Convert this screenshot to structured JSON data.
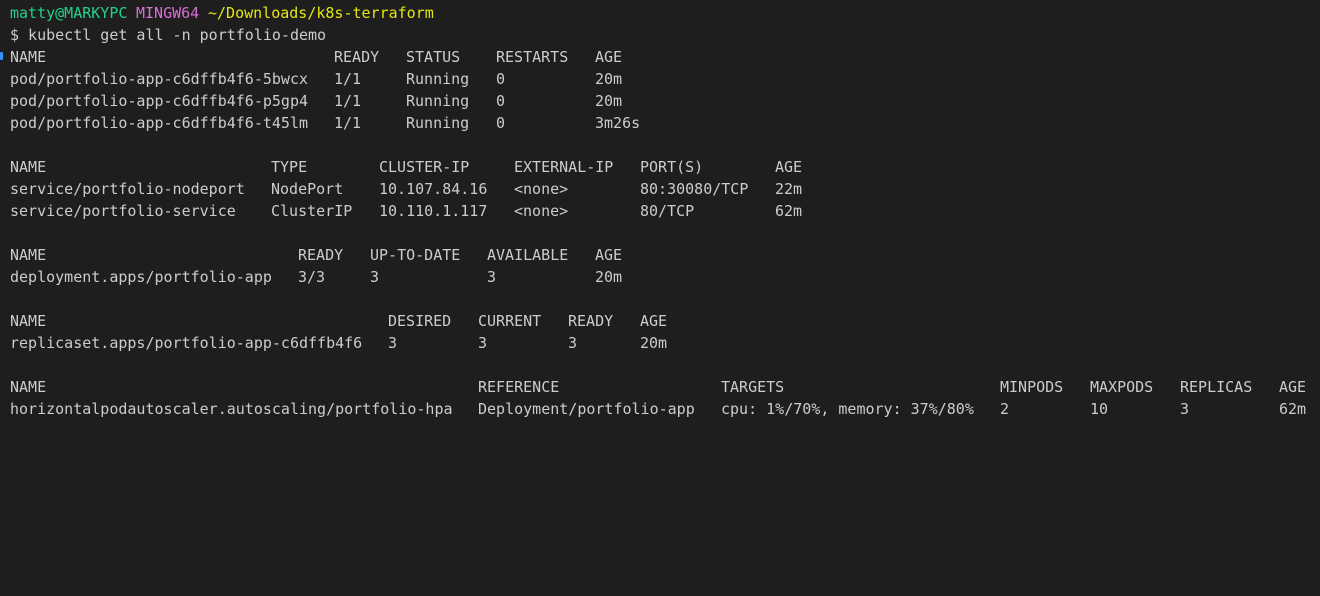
{
  "prompt": {
    "user_host": "matty@MARKYPC",
    "system": "MINGW64",
    "cwd": "~/Downloads/k8s-terraform"
  },
  "command": "$ kubectl get all -n portfolio-demo",
  "sections": [
    {
      "name": "pods",
      "headers": [
        "NAME",
        "READY",
        "STATUS",
        "RESTARTS",
        "AGE"
      ],
      "rows": [
        [
          "pod/portfolio-app-c6dffb4f6-5bwcx",
          "1/1",
          "Running",
          "0",
          "20m"
        ],
        [
          "pod/portfolio-app-c6dffb4f6-p5gp4",
          "1/1",
          "Running",
          "0",
          "20m"
        ],
        [
          "pod/portfolio-app-c6dffb4f6-t45lm",
          "1/1",
          "Running",
          "0",
          "3m26s"
        ]
      ]
    },
    {
      "name": "services",
      "headers": [
        "NAME",
        "TYPE",
        "CLUSTER-IP",
        "EXTERNAL-IP",
        "PORT(S)",
        "AGE"
      ],
      "rows": [
        [
          "service/portfolio-nodeport",
          "NodePort",
          "10.107.84.16",
          "<none>",
          "80:30080/TCP",
          "22m"
        ],
        [
          "service/portfolio-service",
          "ClusterIP",
          "10.110.1.117",
          "<none>",
          "80/TCP",
          "62m"
        ]
      ]
    },
    {
      "name": "deployments",
      "headers": [
        "NAME",
        "READY",
        "UP-TO-DATE",
        "AVAILABLE",
        "AGE"
      ],
      "rows": [
        [
          "deployment.apps/portfolio-app",
          "3/3",
          "3",
          "3",
          "20m"
        ]
      ]
    },
    {
      "name": "replicasets",
      "headers": [
        "NAME",
        "DESIRED",
        "CURRENT",
        "READY",
        "AGE"
      ],
      "rows": [
        [
          "replicaset.apps/portfolio-app-c6dffb4f6",
          "3",
          "3",
          "3",
          "20m"
        ]
      ]
    },
    {
      "name": "hpa",
      "headers": [
        "NAME",
        "REFERENCE",
        "TARGETS",
        "MINPODS",
        "MAXPODS",
        "REPLICAS",
        "AGE"
      ],
      "rows": [
        [
          "horizontalpodautoscaler.autoscaling/portfolio-hpa",
          "Deployment/portfolio-app",
          "cpu: 1%/70%, memory: 37%/80%",
          "2",
          "10",
          "3",
          "62m"
        ]
      ]
    }
  ]
}
